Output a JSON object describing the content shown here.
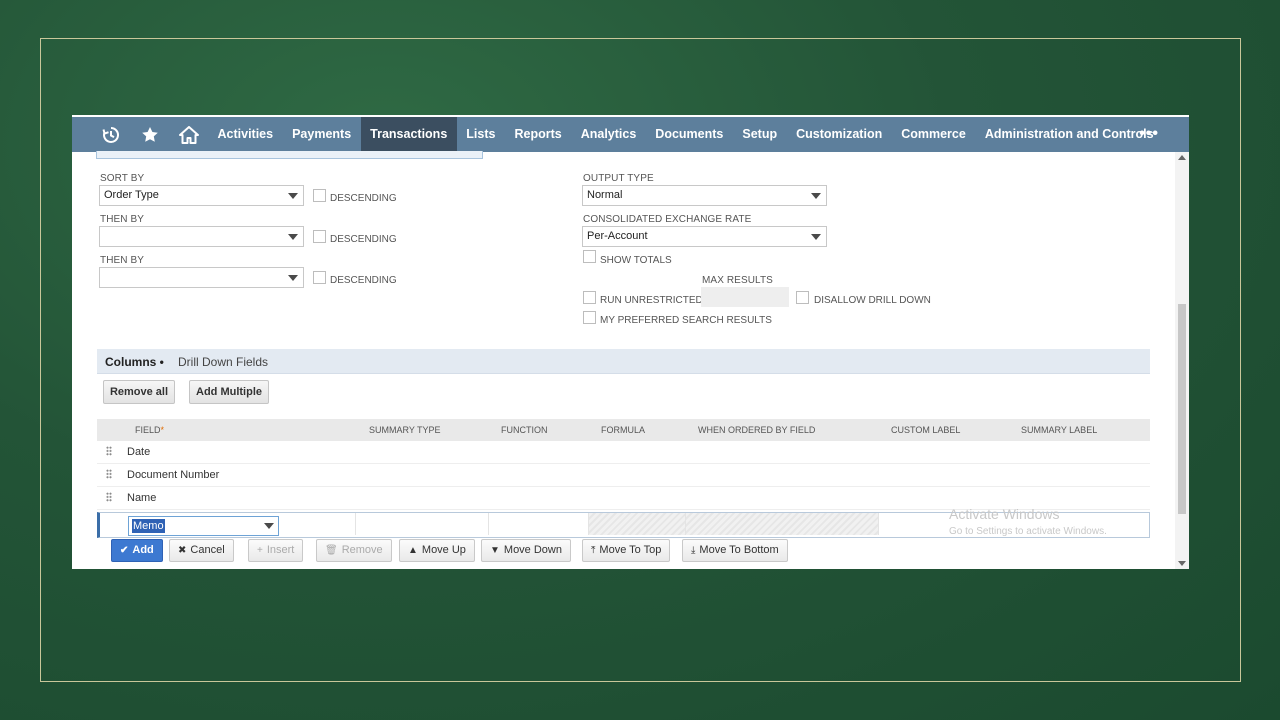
{
  "nav": {
    "icons": [
      "recent-icon",
      "star-icon",
      "home-icon"
    ],
    "items": [
      "Activities",
      "Payments",
      "Transactions",
      "Lists",
      "Reports",
      "Analytics",
      "Documents",
      "Setup",
      "Customization",
      "Commerce",
      "Administration and Controls"
    ],
    "active": "Transactions",
    "more": "•••"
  },
  "sort": {
    "sort_by_label": "SORT BY",
    "sort_by_value": "Order Type",
    "then_by_1_label": "THEN BY",
    "then_by_1_value": "",
    "then_by_2_label": "THEN BY",
    "then_by_2_value": "",
    "descending_label": "DESCENDING"
  },
  "output": {
    "output_type_label": "OUTPUT TYPE",
    "output_type_value": "Normal",
    "exchange_rate_label": "CONSOLIDATED EXCHANGE RATE",
    "exchange_rate_value": "Per-Account",
    "show_totals": "SHOW TOTALS",
    "max_results_label": "MAX RESULTS",
    "run_unrestricted": "RUN UNRESTRICTED",
    "disallow_drill_down": "DISALLOW DRILL DOWN",
    "preferred_results": "MY PREFERRED SEARCH RESULTS"
  },
  "subtabs": {
    "columns": "Columns •",
    "drill_down": "Drill Down Fields"
  },
  "buttons": {
    "remove_all": "Remove all",
    "add_multiple": "Add Multiple"
  },
  "grid": {
    "headers": {
      "field": "FIELD",
      "required_mark": "*",
      "summary_type": "SUMMARY TYPE",
      "function": "FUNCTION",
      "formula": "FORMULA",
      "when_ordered": "WHEN ORDERED BY FIELD",
      "custom_label": "CUSTOM LABEL",
      "summary_label": "SUMMARY LABEL"
    },
    "rows": [
      "Date",
      "Document Number",
      "Name"
    ],
    "editing_value": "Memo"
  },
  "actions": {
    "add": "Add",
    "cancel": "Cancel",
    "insert": "Insert",
    "remove": "Remove",
    "move_up": "Move Up",
    "move_down": "Move Down",
    "move_top": "Move To Top",
    "move_bottom": "Move To Bottom"
  },
  "watermark": {
    "line1": "Activate Windows",
    "line2": "Go to Settings to activate Windows."
  },
  "colors": {
    "nav": "#5d7f9c",
    "nav_active": "#3b4e60",
    "primary": "#3d79d1",
    "background": "#235437"
  }
}
